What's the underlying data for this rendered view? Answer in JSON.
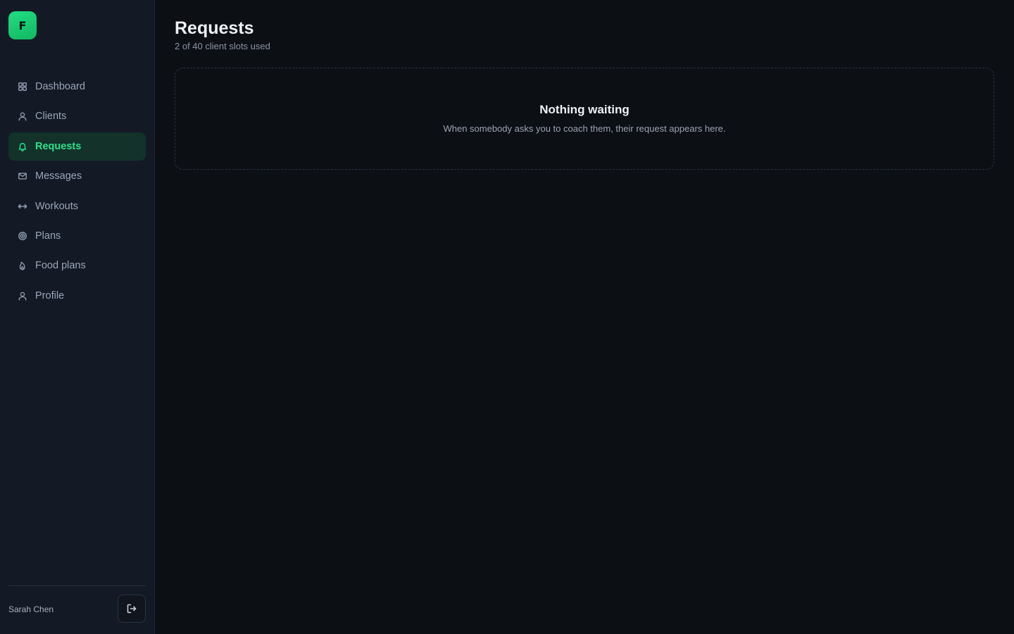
{
  "app": {
    "logo_letter": "F",
    "accent": "#2ce08a"
  },
  "sidebar": {
    "items": [
      {
        "label": "Dashboard",
        "icon": "grid-icon",
        "active": false
      },
      {
        "label": "Clients",
        "icon": "user-icon",
        "active": false
      },
      {
        "label": "Requests",
        "icon": "bell-icon",
        "active": true
      },
      {
        "label": "Messages",
        "icon": "mail-icon",
        "active": false
      },
      {
        "label": "Workouts",
        "icon": "dumbbell-icon",
        "active": false
      },
      {
        "label": "Plans",
        "icon": "target-icon",
        "active": false
      },
      {
        "label": "Food plans",
        "icon": "flame-icon",
        "active": false
      },
      {
        "label": "Profile",
        "icon": "user-icon",
        "active": false
      }
    ],
    "user_name": "Sarah Chen",
    "logout_icon": "logout-icon"
  },
  "main": {
    "title": "Requests",
    "subtitle": "2 of 40 client slots used",
    "empty_state": {
      "title": "Nothing waiting",
      "text": "When somebody asks you to coach them, their request appears here."
    }
  }
}
